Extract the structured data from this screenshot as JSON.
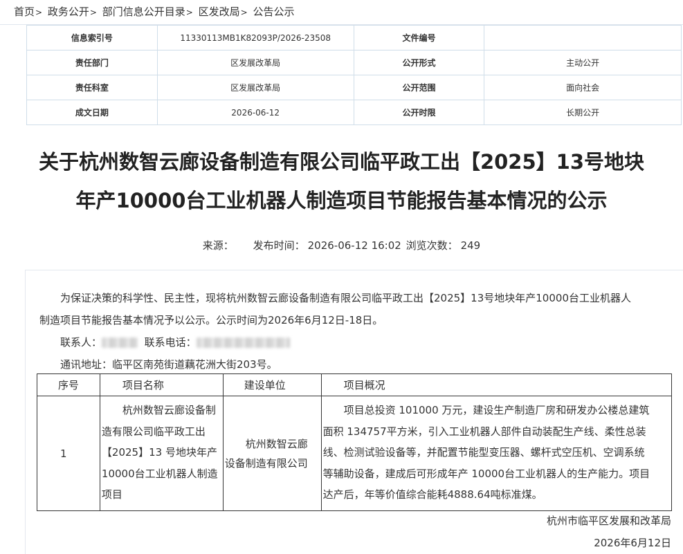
{
  "breadcrumb": [
    "首页",
    "政务公开",
    "部门信息公开目录",
    "区发改局",
    "公告公示"
  ],
  "meta": {
    "rows": [
      {
        "k1": "信息索引号",
        "v1": "11330113MB1K82093P/2026-23508",
        "k2": "文件编号",
        "v2": ""
      },
      {
        "k1": "责任部门",
        "v1": "区发展改革局",
        "k2": "公开形式",
        "v2": "主动公开"
      },
      {
        "k1": "责任科室",
        "v1": "区发展改革局",
        "k2": "公开范围",
        "v2": "面向社会"
      },
      {
        "k1": "成文日期",
        "v1": "2026-06-12",
        "k2": "公开时限",
        "v2": "长期公开"
      }
    ]
  },
  "title": {
    "line1": "关于杭州数智云廊设备制造有限公司临平政工出【2025】13号地块",
    "line2": "年产10000台工业机器人制造项目节能报告基本情况的公示"
  },
  "info": {
    "source_label": "来源：",
    "time_label": "发布时间：",
    "time_value": "2026-06-12 16:02",
    "views_label": "浏览次数：",
    "views_value": "249"
  },
  "body": {
    "intro_line1": "为保证决策的科学性、民主性，现将杭州数智云廊设备制造有限公司临平政工出【2025】13号地块年产10000台工业机器人",
    "intro_line2": "制造项目节能报告基本情况予以公示。公示时间为2026年6月12日-18日。",
    "contact_label": "联系人：",
    "phone_label": "联系电话：",
    "address": "通讯地址：临平区南苑街道藕花洲大街203号。"
  },
  "project_table": {
    "headers": [
      "序号",
      "项目名称",
      "建设单位",
      "项目概况"
    ],
    "row": {
      "idx": "1",
      "name_lines": [
        "杭州数智云廊设备制",
        "造有限公司临平政工出",
        "【2025】13 号地块年产",
        "10000台工业机器人制造",
        "项目"
      ],
      "unit_lines": [
        "杭州数智云廊",
        "设备制造有限公司"
      ],
      "overview_lines": [
        "项目总投资 101000 万元，建设生产制造厂房和研发办公楼总建筑",
        "面积 134757平方米，引入工业机器人部件自动装配生产线、柔性总装",
        "线、检测试验设备等，并配置节能型变压器、螺杆式空压机、空调系统",
        "等辅助设备，建成后可形成年产 10000台工业机器人的生产能力。项目",
        "达产后，年等价值综合能耗4888.64吨标准煤。"
      ]
    }
  },
  "signature": {
    "org": "杭州市临平区发展和改革局",
    "date": "2026年6月12日"
  }
}
